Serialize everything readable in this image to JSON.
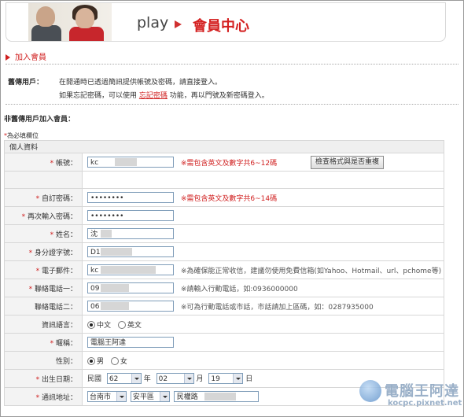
{
  "banner": {
    "play": "play",
    "title": "會員中心"
  },
  "section_title": "加入會員",
  "existing": {
    "label": "舊傳用戶：",
    "line1": "在開通時已透過簡訊提供帳號及密碼，請直接登入。",
    "line2_pre": "如果忘記密碼，可以使用",
    "line2_link": "忘記密碼",
    "line2_post": "功能，再以門號及新密碼登入。"
  },
  "new_user_label": "非舊傳用戶加入會員：",
  "required_note": "為必填欄位",
  "form": {
    "header": "個人資料",
    "account": {
      "label": "帳號：",
      "value": "kc",
      "hint": "※需包含英文及數字共6~12碼",
      "button": "檢查格式與是否重複"
    },
    "password": {
      "label": "自訂密碼：",
      "value": "••••••••",
      "hint": "※需包含英文及數字共6~14碼"
    },
    "password2": {
      "label": "再次輸入密碼：",
      "value": "••••••••"
    },
    "name": {
      "label": "姓名：",
      "value": "沈"
    },
    "id_number": {
      "label": "身分證字號：",
      "value": "D1"
    },
    "email": {
      "label": "電子郵件：",
      "value": "kc",
      "hint": "※為確保能正常收信，建議勿使用免費信箱(如Yahoo、Hotmail、url、pchome等)"
    },
    "phone1": {
      "label": "聯絡電話一：",
      "value": "09",
      "hint": "※請輸入行動電話，如:0936000000"
    },
    "phone2": {
      "label": "聯絡電話二：",
      "value": "06",
      "hint": "※可為行動電話或市話，市話請加上區碼，如：0287935000"
    },
    "language": {
      "label": "資訊語言：",
      "opt1": "中文",
      "opt2": "英文"
    },
    "nickname": {
      "label": "暱稱：",
      "value": "電腦王阿達"
    },
    "gender": {
      "label": "性別：",
      "opt1": "男",
      "opt2": "女"
    },
    "birthday": {
      "label": "出生日期：",
      "era": "民國",
      "year": "62",
      "year_unit": "年",
      "month": "02",
      "month_unit": "月",
      "day": "19",
      "day_unit": "日"
    },
    "address": {
      "label": "通訊地址：",
      "city": "台南市",
      "district": "安平區",
      "street": "民權路"
    }
  },
  "watermark": {
    "text1": "電腦王阿達",
    "text2": "kocpc.pixnet.net"
  },
  "colors": {
    "accent": "#d02020"
  }
}
